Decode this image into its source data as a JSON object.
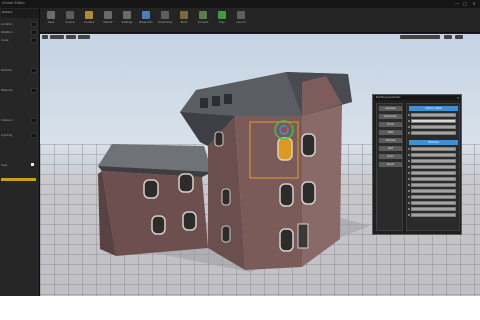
{
  "app": {
    "title": "Unreal Editor",
    "window_controls": [
      "—",
      "□",
      "✕"
    ]
  },
  "left_panel": {
    "header": "Details",
    "rows": [
      "Location",
      "Rotation",
      "Scale",
      "Mobility",
      "Material",
      "Collision",
      "Lighting",
      "Tags"
    ],
    "yellow_accent": "#c8a019"
  },
  "toolbar": {
    "buttons": [
      {
        "label": "Save",
        "icon": "save-icon",
        "color": "#6c6c6c"
      },
      {
        "label": "Source",
        "icon": "source-control-icon",
        "color": "#5b5b5b"
      },
      {
        "label": "Content",
        "icon": "content-icon",
        "color": "#b08a3a"
      },
      {
        "label": "Market",
        "icon": "market-icon",
        "color": "#6a6a6a"
      },
      {
        "label": "Settings",
        "icon": "gear-icon",
        "color": "#6b6b6b"
      },
      {
        "label": "Blueprints",
        "icon": "blueprint-icon",
        "color": "#4a7fb6"
      },
      {
        "label": "Cinematics",
        "icon": "cinematics-icon",
        "color": "#5e5e5e"
      },
      {
        "label": "Build",
        "icon": "build-icon",
        "color": "#7a6b3c"
      },
      {
        "label": "Compile",
        "icon": "compile-icon",
        "color": "#5f7d4a"
      },
      {
        "label": "Play",
        "icon": "play-icon",
        "color": "#3e9a44"
      },
      {
        "label": "Launch",
        "icon": "launch-icon",
        "color": "#5e5e5e"
      }
    ]
  },
  "plugin_window": {
    "title": "Building Generator",
    "close": "✕",
    "left_buttons": [
      "Generate",
      "Randomize",
      "Floors",
      "Walls",
      "Windows",
      "Roof",
      "Doors",
      "Export"
    ],
    "sections": [
      {
        "title": "Exterior Walls",
        "items": 4
      },
      {
        "title": "Windows",
        "items": 12
      }
    ],
    "accent": "#3d8fd6"
  }
}
